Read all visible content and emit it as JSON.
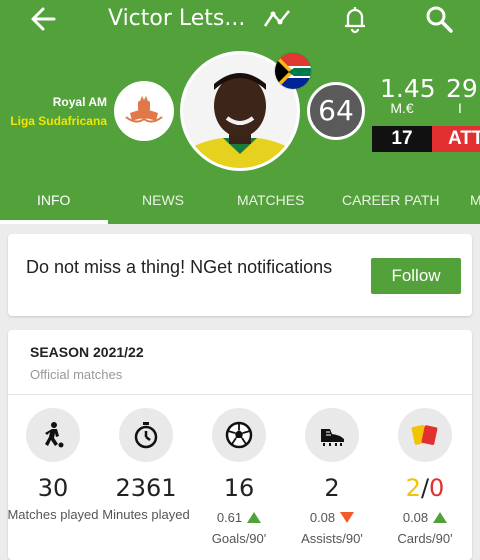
{
  "header": {
    "title": "Victor Lets...",
    "club": "Royal AM",
    "league": "Liga Sudafricana",
    "rating": "64",
    "market_value": "1.45",
    "market_value_unit": "M.€",
    "age": "29",
    "age_unit": "I",
    "shirt_number": "17",
    "position": "ATT",
    "icons": [
      "back-arrow-icon",
      "trend-icon",
      "bell-icon",
      "search-icon"
    ]
  },
  "tabs": [
    {
      "label": "INFO",
      "active": true
    },
    {
      "label": "NEWS"
    },
    {
      "label": "MATCHES"
    },
    {
      "label": "CAREER PATH"
    },
    {
      "label": "M"
    }
  ],
  "notification": {
    "text": "Do not miss a thing!  NGet notifications",
    "button": "Follow"
  },
  "season": {
    "title": "SEASON 2021/22",
    "subtitle": "Official matches",
    "stats": [
      {
        "icon": "player-icon",
        "value": "30",
        "label": "Matches played"
      },
      {
        "icon": "stopwatch-icon",
        "value": "2361",
        "label": "Minutes played"
      },
      {
        "icon": "ball-icon",
        "value": "16",
        "sub_value": "0.61",
        "trend": "up",
        "label": "Goals/90'"
      },
      {
        "icon": "boot-icon",
        "value": "2",
        "sub_value": "0.08",
        "trend": "down",
        "label": "Assists/90'"
      },
      {
        "icon": "cards-icon",
        "value_yellow": "2",
        "value_sep": "/",
        "value_red": "0",
        "sub_value": "0.08",
        "trend": "up",
        "label": "Cards/90'"
      }
    ]
  },
  "colors": {
    "brand_green": "#52a13b",
    "position_red": "#e23031",
    "rating_grey": "#5a5a5a",
    "league_yellow": "#f2e600"
  }
}
